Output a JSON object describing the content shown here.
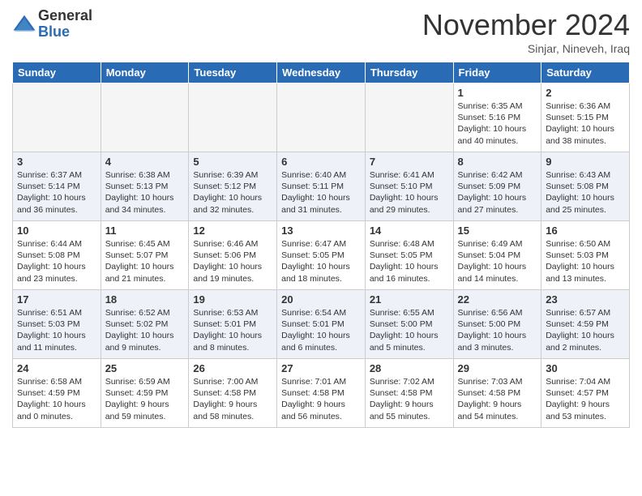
{
  "logo": {
    "general": "General",
    "blue": "Blue"
  },
  "title": "November 2024",
  "subtitle": "Sinjar, Nineveh, Iraq",
  "days_of_week": [
    "Sunday",
    "Monday",
    "Tuesday",
    "Wednesday",
    "Thursday",
    "Friday",
    "Saturday"
  ],
  "weeks": [
    [
      {
        "day": "",
        "content": ""
      },
      {
        "day": "",
        "content": ""
      },
      {
        "day": "",
        "content": ""
      },
      {
        "day": "",
        "content": ""
      },
      {
        "day": "",
        "content": ""
      },
      {
        "day": "1",
        "content": "Sunrise: 6:35 AM\nSunset: 5:16 PM\nDaylight: 10 hours and 40 minutes."
      },
      {
        "day": "2",
        "content": "Sunrise: 6:36 AM\nSunset: 5:15 PM\nDaylight: 10 hours and 38 minutes."
      }
    ],
    [
      {
        "day": "3",
        "content": "Sunrise: 6:37 AM\nSunset: 5:14 PM\nDaylight: 10 hours and 36 minutes."
      },
      {
        "day": "4",
        "content": "Sunrise: 6:38 AM\nSunset: 5:13 PM\nDaylight: 10 hours and 34 minutes."
      },
      {
        "day": "5",
        "content": "Sunrise: 6:39 AM\nSunset: 5:12 PM\nDaylight: 10 hours and 32 minutes."
      },
      {
        "day": "6",
        "content": "Sunrise: 6:40 AM\nSunset: 5:11 PM\nDaylight: 10 hours and 31 minutes."
      },
      {
        "day": "7",
        "content": "Sunrise: 6:41 AM\nSunset: 5:10 PM\nDaylight: 10 hours and 29 minutes."
      },
      {
        "day": "8",
        "content": "Sunrise: 6:42 AM\nSunset: 5:09 PM\nDaylight: 10 hours and 27 minutes."
      },
      {
        "day": "9",
        "content": "Sunrise: 6:43 AM\nSunset: 5:08 PM\nDaylight: 10 hours and 25 minutes."
      }
    ],
    [
      {
        "day": "10",
        "content": "Sunrise: 6:44 AM\nSunset: 5:08 PM\nDaylight: 10 hours and 23 minutes."
      },
      {
        "day": "11",
        "content": "Sunrise: 6:45 AM\nSunset: 5:07 PM\nDaylight: 10 hours and 21 minutes."
      },
      {
        "day": "12",
        "content": "Sunrise: 6:46 AM\nSunset: 5:06 PM\nDaylight: 10 hours and 19 minutes."
      },
      {
        "day": "13",
        "content": "Sunrise: 6:47 AM\nSunset: 5:05 PM\nDaylight: 10 hours and 18 minutes."
      },
      {
        "day": "14",
        "content": "Sunrise: 6:48 AM\nSunset: 5:05 PM\nDaylight: 10 hours and 16 minutes."
      },
      {
        "day": "15",
        "content": "Sunrise: 6:49 AM\nSunset: 5:04 PM\nDaylight: 10 hours and 14 minutes."
      },
      {
        "day": "16",
        "content": "Sunrise: 6:50 AM\nSunset: 5:03 PM\nDaylight: 10 hours and 13 minutes."
      }
    ],
    [
      {
        "day": "17",
        "content": "Sunrise: 6:51 AM\nSunset: 5:03 PM\nDaylight: 10 hours and 11 minutes."
      },
      {
        "day": "18",
        "content": "Sunrise: 6:52 AM\nSunset: 5:02 PM\nDaylight: 10 hours and 9 minutes."
      },
      {
        "day": "19",
        "content": "Sunrise: 6:53 AM\nSunset: 5:01 PM\nDaylight: 10 hours and 8 minutes."
      },
      {
        "day": "20",
        "content": "Sunrise: 6:54 AM\nSunset: 5:01 PM\nDaylight: 10 hours and 6 minutes."
      },
      {
        "day": "21",
        "content": "Sunrise: 6:55 AM\nSunset: 5:00 PM\nDaylight: 10 hours and 5 minutes."
      },
      {
        "day": "22",
        "content": "Sunrise: 6:56 AM\nSunset: 5:00 PM\nDaylight: 10 hours and 3 minutes."
      },
      {
        "day": "23",
        "content": "Sunrise: 6:57 AM\nSunset: 4:59 PM\nDaylight: 10 hours and 2 minutes."
      }
    ],
    [
      {
        "day": "24",
        "content": "Sunrise: 6:58 AM\nSunset: 4:59 PM\nDaylight: 10 hours and 0 minutes."
      },
      {
        "day": "25",
        "content": "Sunrise: 6:59 AM\nSunset: 4:59 PM\nDaylight: 9 hours and 59 minutes."
      },
      {
        "day": "26",
        "content": "Sunrise: 7:00 AM\nSunset: 4:58 PM\nDaylight: 9 hours and 58 minutes."
      },
      {
        "day": "27",
        "content": "Sunrise: 7:01 AM\nSunset: 4:58 PM\nDaylight: 9 hours and 56 minutes."
      },
      {
        "day": "28",
        "content": "Sunrise: 7:02 AM\nSunset: 4:58 PM\nDaylight: 9 hours and 55 minutes."
      },
      {
        "day": "29",
        "content": "Sunrise: 7:03 AM\nSunset: 4:58 PM\nDaylight: 9 hours and 54 minutes."
      },
      {
        "day": "30",
        "content": "Sunrise: 7:04 AM\nSunset: 4:57 PM\nDaylight: 9 hours and 53 minutes."
      }
    ]
  ]
}
